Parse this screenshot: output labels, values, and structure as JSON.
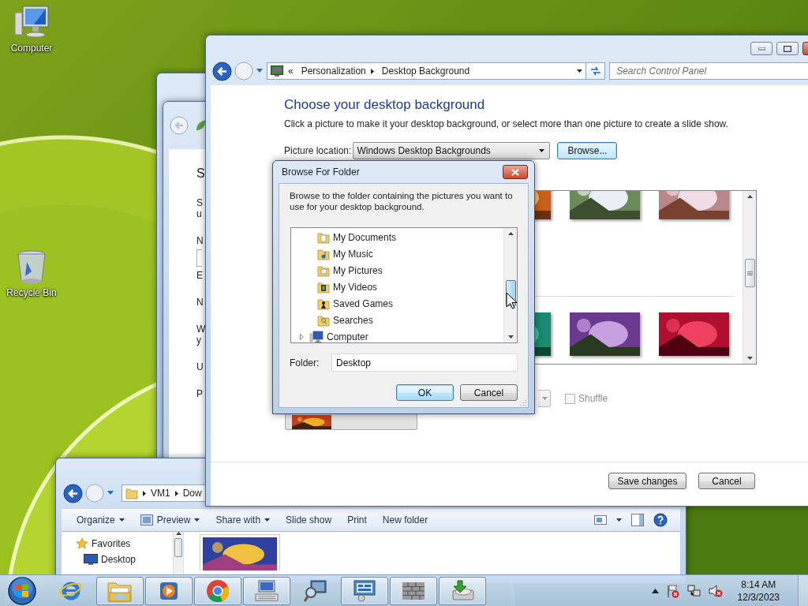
{
  "desktop_icons": [
    {
      "label": "Computer",
      "kind": "computer"
    },
    {
      "label": "Recycle Bin",
      "kind": "recycle-bin"
    }
  ],
  "background_window": {
    "lines": [
      {
        "text": "S",
        "kind": "title"
      },
      {
        "text": "S",
        "kind": "text"
      },
      {
        "text": "u",
        "kind": "wrap"
      },
      {
        "text": "N",
        "kind": "text"
      },
      {
        "kind": "field"
      },
      {
        "text": "E",
        "kind": "label"
      },
      {
        "text": "N",
        "kind": "text"
      },
      {
        "text": "W",
        "kind": "text"
      },
      {
        "text": "y",
        "kind": "wrap"
      },
      {
        "text": "U",
        "kind": "text"
      },
      {
        "text": "P",
        "kind": "text"
      }
    ]
  },
  "explorer_window": {
    "address": [
      "VM1",
      "Dow"
    ],
    "toolbar": [
      {
        "label": "Organize",
        "kind": "menu"
      },
      {
        "label": "Preview",
        "kind": "icon-menu"
      },
      {
        "label": "Share with",
        "kind": "menu"
      },
      {
        "label": "Slide show",
        "kind": "plain"
      },
      {
        "label": "Print",
        "kind": "plain"
      },
      {
        "label": "New folder",
        "kind": "plain"
      }
    ],
    "nav": [
      {
        "label": "Favorites",
        "kind": "star"
      },
      {
        "label": "Desktop",
        "kind": "desktop"
      }
    ],
    "files": [
      {
        "kind": "picture"
      }
    ]
  },
  "control_panel": {
    "breadcrumb_prefix": "«",
    "breadcrumb": [
      "Personalization",
      "Desktop Background"
    ],
    "search": {
      "placeholder": "Search Control Panel"
    },
    "heading": "Choose your desktop background",
    "description": "Click a picture to make it your desktop background, or select more than one picture to create a slide show.",
    "picture_location": {
      "label": "Picture location:",
      "value": "Windows Desktop Backgrounds"
    },
    "browse_button": "Browse...",
    "thumbnail_rows": [
      {
        "pictures": [
          {
            "kind": "picture"
          },
          {
            "kind": "picture"
          },
          {
            "kind": "picture"
          }
        ]
      },
      {
        "pictures": [
          {
            "kind": "picture"
          },
          {
            "kind": "picture"
          },
          {
            "kind": "picture"
          }
        ]
      }
    ],
    "shuffle": {
      "label": "Shuffle",
      "checked": false,
      "disabled": true
    },
    "buttons": [
      "Save changes",
      "Cancel"
    ]
  },
  "browse_dialog": {
    "title": "Browse For Folder",
    "instructions": "Browse to the folder containing the pictures you want to use for your desktop background.",
    "tree": [
      {
        "children": [
          {
            "label": "My Documents",
            "kind": "documents"
          },
          {
            "label": "My Music",
            "kind": "music"
          },
          {
            "label": "My Pictures",
            "kind": "pictures"
          },
          {
            "label": "My Videos",
            "kind": "videos"
          },
          {
            "label": "Saved Games",
            "kind": "games"
          },
          {
            "label": "Searches",
            "kind": "searches"
          }
        ]
      },
      {
        "label": "Computer",
        "kind": "computer",
        "expanded": false
      }
    ],
    "folder": {
      "label": "Folder:",
      "value": "Desktop"
    },
    "buttons": [
      {
        "label": "OK",
        "default": true
      },
      {
        "label": "Cancel",
        "default": false
      }
    ]
  },
  "taskbar": {
    "items": [
      {
        "kind": "browser",
        "running": false
      },
      {
        "kind": "explorer",
        "running": true
      },
      {
        "kind": "media",
        "running": true
      },
      {
        "kind": "chrome",
        "running": true
      },
      {
        "kind": "keyboard",
        "running": true
      },
      {
        "kind": "magnifier",
        "running": false
      },
      {
        "kind": "control-panel",
        "running": true
      },
      {
        "kind": "firewall",
        "running": true
      },
      {
        "kind": "installer",
        "running": true
      }
    ],
    "clock": {
      "time": "8:14 AM",
      "date": "12/3/2023"
    }
  }
}
